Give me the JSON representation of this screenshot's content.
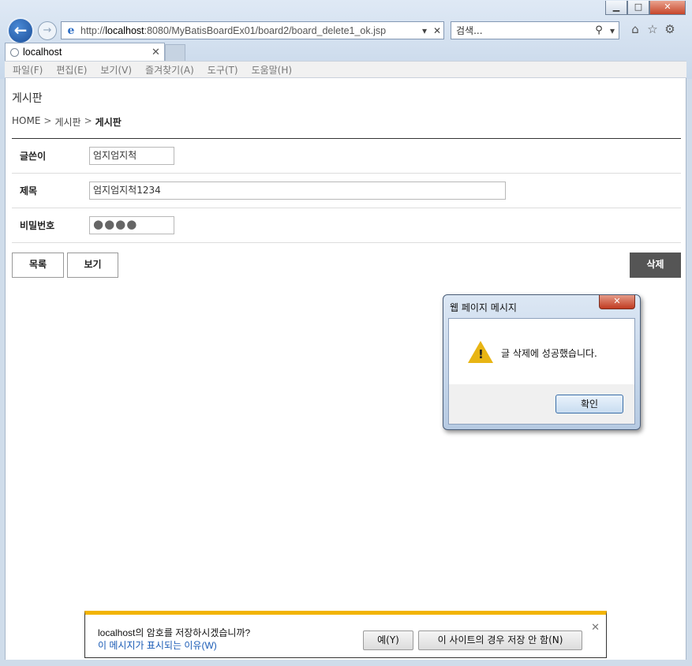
{
  "window": {
    "minimize": "▁",
    "maximize": "□",
    "close": "✕"
  },
  "nav": {
    "back": "←",
    "forward": "→"
  },
  "address": {
    "prefix": "http://",
    "host": "localhost",
    "path": ":8080/MyBatisBoardEx01/board2/board_delete1_ok.jsp",
    "dropdown": "▾",
    "stop": "✕"
  },
  "search": {
    "placeholder": "검색...",
    "icon": "⚲",
    "dropdown": "▾"
  },
  "toolbar_icons": {
    "home": "⌂",
    "favorites": "☆",
    "settings": "⚙"
  },
  "tab": {
    "label": "localhost",
    "close": "✕"
  },
  "menu": [
    "파일(F)",
    "편집(E)",
    "보기(V)",
    "즐겨찾기(A)",
    "도구(T)",
    "도움말(H)"
  ],
  "page": {
    "title": "게시판",
    "breadcrumb": {
      "home": "HOME",
      "sep": ">",
      "level1": "게시판",
      "current": "게시판"
    },
    "form": {
      "writer_label": "글쓴이",
      "writer_value": "엄지엄지척",
      "subject_label": "제목",
      "subject_value": "엄지엄지척1234",
      "password_label": "비밀번호",
      "password_value": "●●●●"
    },
    "buttons": {
      "list": "목록",
      "view": "보기",
      "delete": "삭제"
    }
  },
  "dialog": {
    "title": "웹 페이지 메시지",
    "close": "✕",
    "warning_mark": "!",
    "message": "글 삭제에 성공했습니다.",
    "ok": "확인"
  },
  "notification": {
    "question": "localhost의 암호를 저장하시겠습니까?",
    "link": "이 메시지가 표시되는 이유(W)",
    "yes": "예(Y)",
    "never": "이 사이트의 경우 저장 안 함(N)",
    "close": "✕"
  }
}
